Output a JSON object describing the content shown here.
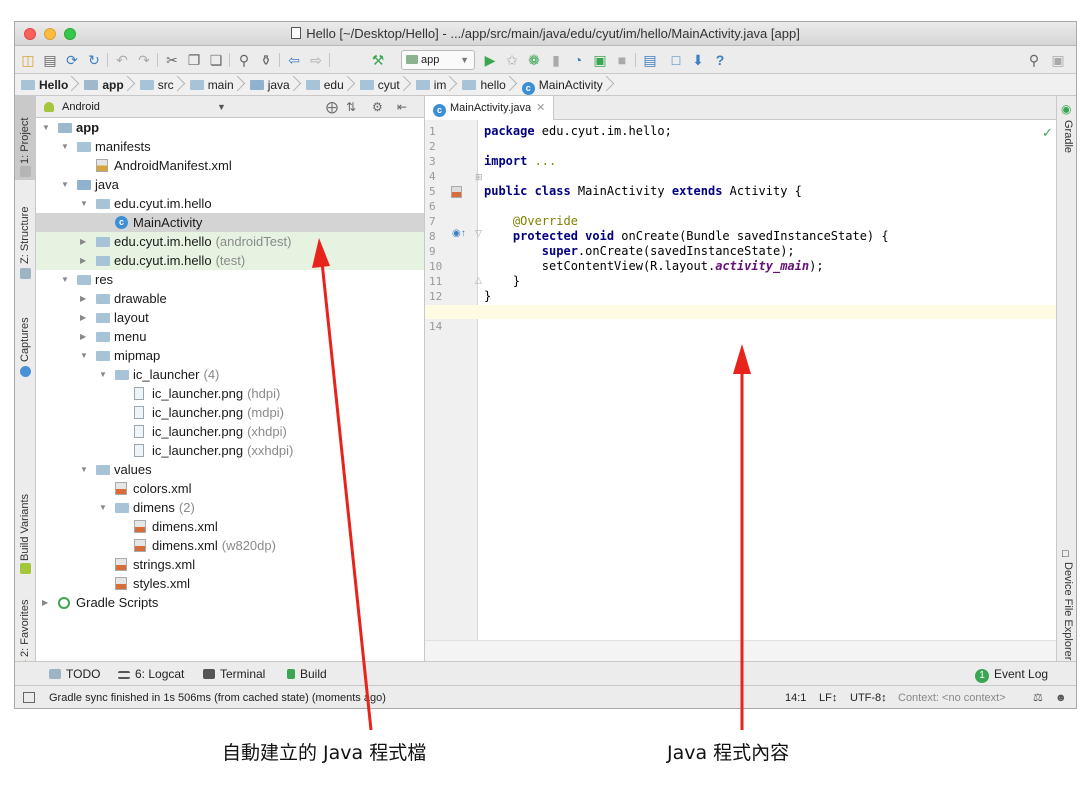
{
  "window": {
    "title": "Hello [~/Desktop/Hello] - .../app/src/main/java/edu/cyut/im/hello/MainActivity.java [app]"
  },
  "toolbar": {
    "run_config": "app"
  },
  "breadcrumb": [
    "Hello",
    "app",
    "src",
    "main",
    "java",
    "edu",
    "cyut",
    "im",
    "hello",
    "MainActivity"
  ],
  "left_strip": {
    "tabs": [
      "1: Project",
      "Z: Structure",
      "Captures",
      "Build Variants",
      "2: Favorites"
    ]
  },
  "project_panel": {
    "view": "Android",
    "tree": [
      {
        "label": "app",
        "suffix": "",
        "depth": 0,
        "open": true,
        "icon": "module-folder"
      },
      {
        "label": "manifests",
        "suffix": "",
        "depth": 1,
        "open": true,
        "icon": "folder"
      },
      {
        "label": "AndroidManifest.xml",
        "suffix": "",
        "depth": 2,
        "open": null,
        "icon": "manifest-file"
      },
      {
        "label": "java",
        "suffix": "",
        "depth": 1,
        "open": true,
        "icon": "source-folder"
      },
      {
        "label": "edu.cyut.im.hello",
        "suffix": "",
        "depth": 2,
        "open": true,
        "icon": "package"
      },
      {
        "label": "MainActivity",
        "suffix": "",
        "depth": 3,
        "open": null,
        "icon": "class",
        "selected": true
      },
      {
        "label": "edu.cyut.im.hello",
        "suffix": "(androidTest)",
        "depth": 2,
        "open": false,
        "icon": "package",
        "test": true
      },
      {
        "label": "edu.cyut.im.hello",
        "suffix": "(test)",
        "depth": 2,
        "open": false,
        "icon": "package",
        "test": true
      },
      {
        "label": "res",
        "suffix": "",
        "depth": 1,
        "open": true,
        "icon": "res-folder"
      },
      {
        "label": "drawable",
        "suffix": "",
        "depth": 2,
        "open": false,
        "icon": "folder"
      },
      {
        "label": "layout",
        "suffix": "",
        "depth": 2,
        "open": false,
        "icon": "folder"
      },
      {
        "label": "menu",
        "suffix": "",
        "depth": 2,
        "open": false,
        "icon": "folder"
      },
      {
        "label": "mipmap",
        "suffix": "",
        "depth": 2,
        "open": true,
        "icon": "folder"
      },
      {
        "label": "ic_launcher",
        "suffix": "(4)",
        "depth": 3,
        "open": true,
        "icon": "folder"
      },
      {
        "label": "ic_launcher.png",
        "suffix": "(hdpi)",
        "depth": 4,
        "open": null,
        "icon": "png-file"
      },
      {
        "label": "ic_launcher.png",
        "suffix": "(mdpi)",
        "depth": 4,
        "open": null,
        "icon": "png-file"
      },
      {
        "label": "ic_launcher.png",
        "suffix": "(xhdpi)",
        "depth": 4,
        "open": null,
        "icon": "png-file"
      },
      {
        "label": "ic_launcher.png",
        "suffix": "(xxhdpi)",
        "depth": 4,
        "open": null,
        "icon": "png-file"
      },
      {
        "label": "values",
        "suffix": "",
        "depth": 2,
        "open": true,
        "icon": "folder"
      },
      {
        "label": "colors.xml",
        "suffix": "",
        "depth": 3,
        "open": null,
        "icon": "xml-file"
      },
      {
        "label": "dimens",
        "suffix": "(2)",
        "depth": 3,
        "open": true,
        "icon": "folder"
      },
      {
        "label": "dimens.xml",
        "suffix": "",
        "depth": 4,
        "open": null,
        "icon": "xml-file"
      },
      {
        "label": "dimens.xml",
        "suffix": "(w820dp)",
        "depth": 4,
        "open": null,
        "icon": "xml-file"
      },
      {
        "label": "strings.xml",
        "suffix": "",
        "depth": 3,
        "open": null,
        "icon": "xml-file"
      },
      {
        "label": "styles.xml",
        "suffix": "",
        "depth": 3,
        "open": null,
        "icon": "xml-file"
      },
      {
        "label": "Gradle Scripts",
        "suffix": "",
        "depth": 0,
        "open": false,
        "icon": "gradle"
      }
    ]
  },
  "editor": {
    "tab": "MainActivity.java",
    "lines": [
      [
        {
          "t": "package ",
          "c": "kw"
        },
        {
          "t": "edu.cyut.im.hello;",
          "c": ""
        }
      ],
      [],
      [
        {
          "t": "import ",
          "c": "kw"
        },
        {
          "t": "...",
          "c": "ann"
        }
      ],
      [],
      [
        {
          "t": "public class ",
          "c": "kw"
        },
        {
          "t": "MainActivity ",
          "c": ""
        },
        {
          "t": "extends ",
          "c": "kw"
        },
        {
          "t": "Activity {",
          "c": ""
        }
      ],
      [],
      [
        {
          "t": "    @Override",
          "c": "ann"
        }
      ],
      [
        {
          "t": "    protected void ",
          "c": "kw"
        },
        {
          "t": "onCreate(Bundle savedInstanceState) {",
          "c": ""
        }
      ],
      [
        {
          "t": "        super",
          "c": "kw"
        },
        {
          "t": ".onCreate(savedInstanceState);",
          "c": ""
        }
      ],
      [
        {
          "t": "        setContentView(R.layout.",
          "c": ""
        },
        {
          "t": "activity_main",
          "c": "fld"
        },
        {
          "t": ");",
          "c": ""
        }
      ],
      [
        {
          "t": "    }",
          "c": ""
        }
      ],
      [
        {
          "t": "}",
          "c": ""
        }
      ],
      [],
      []
    ]
  },
  "right_strip": {
    "tabs": [
      "Gradle",
      "Device File Explorer"
    ]
  },
  "bottom_tools": {
    "todo": "TODO",
    "logcat": "6: Logcat",
    "terminal": "Terminal",
    "build": "Build",
    "event_log": "Event Log",
    "event_count": "1"
  },
  "status": {
    "message": "Gradle sync finished in 1s 506ms (from cached state) (moments ago)",
    "position": "14:1",
    "line_sep": "LF↕",
    "encoding": "UTF-8↕",
    "context": "Context: <no context>"
  },
  "annotations": {
    "left": "自動建立的 Java 程式檔",
    "right": "Java 程式內容"
  },
  "colors": {
    "arrow": "#e8231b",
    "selection": "#d4d4d4",
    "test_row": "#e7f3e1",
    "keyword": "#000080"
  }
}
